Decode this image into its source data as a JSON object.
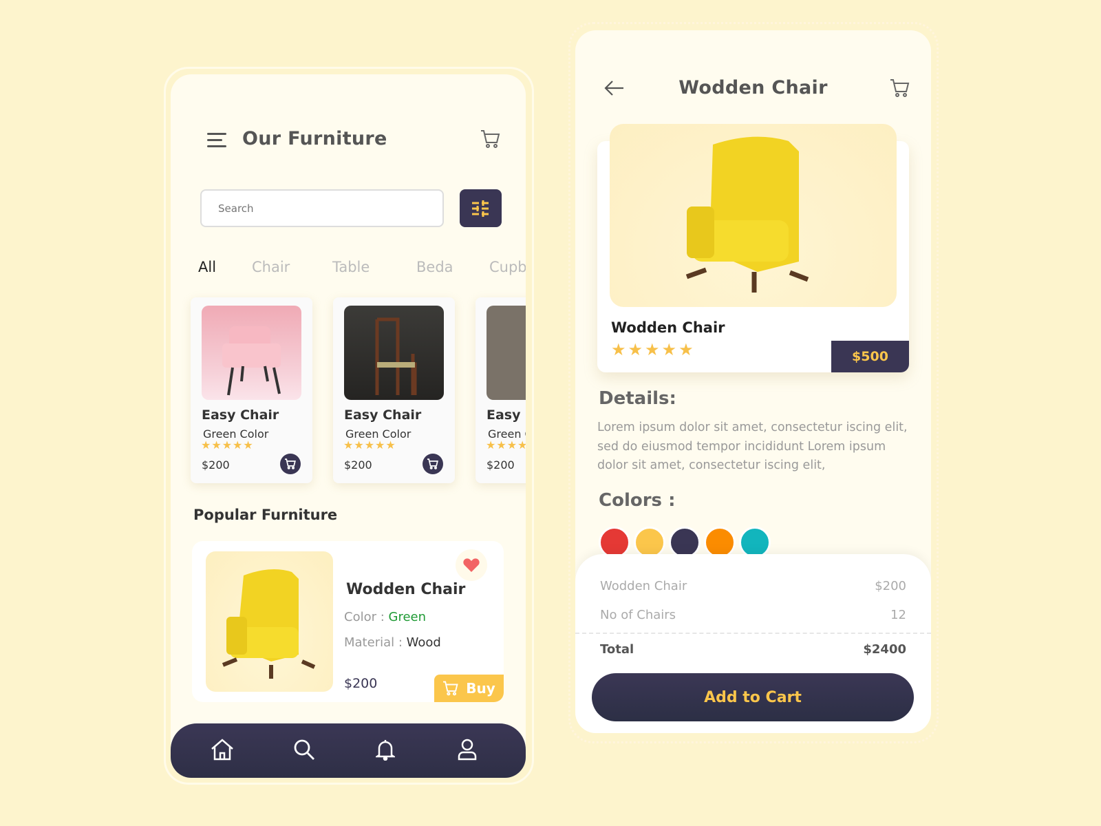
{
  "list_screen": {
    "title": "Our Furniture",
    "search_placeholder": "Search",
    "tabs": [
      {
        "label": "All",
        "active": true
      },
      {
        "label": "Chair"
      },
      {
        "label": "Table"
      },
      {
        "label": "Beda"
      },
      {
        "label": "Cupb"
      }
    ],
    "products": [
      {
        "name": "Easy Chair",
        "color": "Green Color",
        "stars": "★★★★★",
        "price": "$200"
      },
      {
        "name": "Easy Chair",
        "color": "Green Color",
        "stars": "★★★★★",
        "price": "$200"
      },
      {
        "name": "Easy Chair",
        "color": "Green Color",
        "stars": "★★★★★",
        "price": "$200"
      }
    ],
    "popular_title": "Popular Furniture",
    "popular": {
      "name": "Wodden Chair",
      "color_label": "Color :",
      "color_value": "Green",
      "material_label": "Material :",
      "material_value": "Wood",
      "price": "$200",
      "buy_label": "Buy",
      "favorited": true
    },
    "nav": [
      "home-icon",
      "search-icon",
      "bell-icon",
      "user-icon"
    ]
  },
  "detail_screen": {
    "title": "Wodden Chair",
    "product_name": "Wodden Chair",
    "stars": "★★★★★",
    "price": "$500",
    "details_title": "Details:",
    "details_text": "Lorem ipsum dolor sit amet, consectetur iscing elit, sed do eiusmod tempor incididunt Lorem ipsum dolor sit amet, consectetur iscing elit,",
    "colors_title": "Colors :",
    "colors": [
      "#e53935",
      "#fbc64b",
      "#3a3654",
      "#fb8c00",
      "#12b5bd"
    ],
    "summary": {
      "item_label": "Wodden Chair",
      "item_price": "$200",
      "qty_label": "No of Chairs",
      "qty_value": "12",
      "total_label": "Total",
      "total_value": "$2400"
    },
    "add_to_cart": "Add to Cart"
  },
  "accent": {
    "dark": "#3a3654",
    "yellow": "#fbc64b",
    "green": "#1e9a34"
  }
}
